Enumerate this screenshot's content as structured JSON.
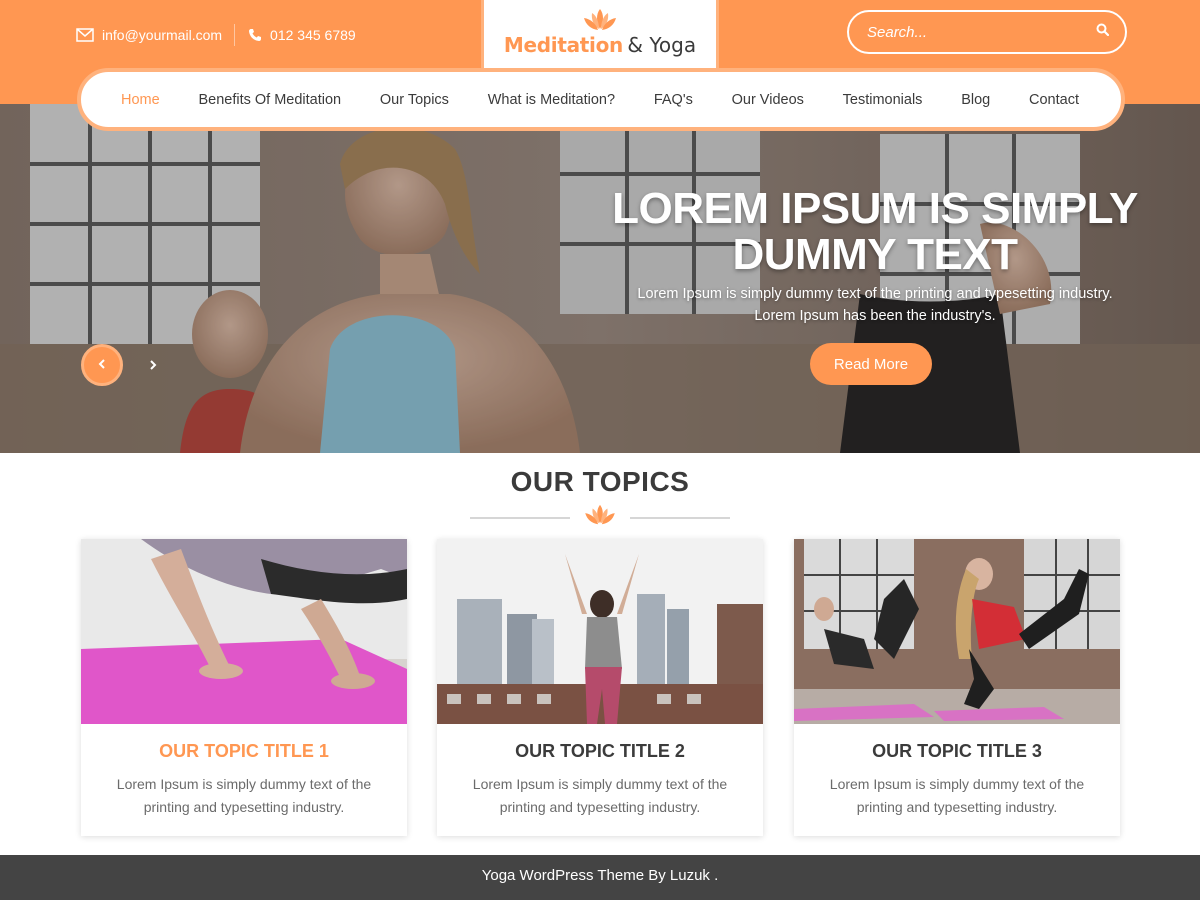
{
  "colors": {
    "accent": "#ff9752",
    "accent_light": "#ffb27d",
    "footer_bg": "#444444",
    "text": "#3b3b3b"
  },
  "header": {
    "email": "info@yourmail.com",
    "phone": "012 345 6789",
    "logo": {
      "main": "Meditation",
      "sub": "& Yoga",
      "icon": "lotus-icon"
    },
    "search": {
      "placeholder": "Search...",
      "icon": "search-icon"
    }
  },
  "nav": {
    "items": [
      {
        "label": "Home",
        "active": true
      },
      {
        "label": "Benefits Of Meditation"
      },
      {
        "label": "Our Topics"
      },
      {
        "label": "What is Meditation?"
      },
      {
        "label": "FAQ's"
      },
      {
        "label": "Our Videos"
      },
      {
        "label": "Testimonials"
      },
      {
        "label": "Blog"
      },
      {
        "label": "Contact"
      }
    ]
  },
  "hero": {
    "title_line1": "LOREM IPSUM IS SIMPLY",
    "title_line2": "DUMMY TEXT",
    "description": "Lorem Ipsum is simply dummy text of the printing and typesetting industry. Lorem Ipsum has been the industry's.",
    "button": "Read More",
    "prev_icon": "chevron-left-icon",
    "next_icon": "chevron-right-icon"
  },
  "topics": {
    "title": "OUR TOPICS",
    "cards": [
      {
        "title": "OUR TOPIC TITLE 1",
        "text": "Lorem Ipsum is simply dummy text of the printing and typesetting industry."
      },
      {
        "title": "OUR TOPIC TITLE 2",
        "text": "Lorem Ipsum is simply dummy text of the printing and typesetting industry."
      },
      {
        "title": "OUR TOPIC TITLE 3",
        "text": "Lorem Ipsum is simply dummy text of the printing and typesetting industry."
      }
    ]
  },
  "footer": {
    "text": "Yoga WordPress Theme By Luzuk ."
  }
}
